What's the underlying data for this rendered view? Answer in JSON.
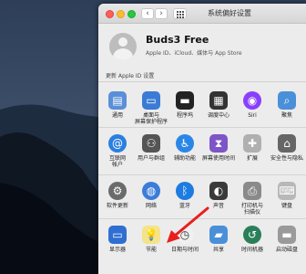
{
  "window": {
    "title": "系统偏好设置"
  },
  "nav": {
    "back": "‹",
    "forward": "›"
  },
  "account": {
    "name": "Buds3 Free",
    "subtitle": "Apple ID、iCloud、媒体与 App Store",
    "update_label": "更新 Apple ID 设置"
  },
  "rows": [
    [
      {
        "label": "通用",
        "icon": "file-icon",
        "color": "#5a8fd8"
      },
      {
        "label": "桌面与\n屏幕保护程序",
        "icon": "desktop-icon",
        "color": "#3a7bd5"
      },
      {
        "label": "程序坞",
        "icon": "dock-icon",
        "color": "#222222"
      },
      {
        "label": "调度中心",
        "icon": "mission-control-icon",
        "color": "#333333"
      },
      {
        "label": "Siri",
        "icon": "siri-icon",
        "color": "#8a3ffc"
      },
      {
        "label": "聚焦",
        "icon": "search-icon",
        "color": "#4a90d9"
      }
    ],
    [
      {
        "label": "互联网\n帐户",
        "icon": "at-icon",
        "color": "#2a7fe0"
      },
      {
        "label": "用户与群组",
        "icon": "users-icon",
        "color": "#555555"
      },
      {
        "label": "辅助功能",
        "icon": "accessibility-icon",
        "color": "#2a86e6"
      },
      {
        "label": "屏幕使用时间",
        "icon": "hourglass-icon",
        "color": "#7d55c7"
      },
      {
        "label": "扩展",
        "icon": "puzzle-icon",
        "color": "#b0b0b0"
      },
      {
        "label": "安全性与隐私",
        "icon": "house-icon",
        "color": "#666666"
      }
    ],
    [
      {
        "label": "软件更新",
        "icon": "gear-icon",
        "color": "#6b6b6b"
      },
      {
        "label": "网络",
        "icon": "globe-icon",
        "color": "#3b7dd8"
      },
      {
        "label": "蓝牙",
        "icon": "bluetooth-icon",
        "color": "#1e7be0"
      },
      {
        "label": "声音",
        "icon": "speaker-icon",
        "color": "#3a3a3a"
      },
      {
        "label": "打印机与\n扫描仪",
        "icon": "printer-icon",
        "color": "#8a8a8a"
      },
      {
        "label": "键盘",
        "icon": "keyboard-icon",
        "color": "#b8b8b8"
      }
    ],
    [
      {
        "label": "显示器",
        "icon": "display-icon",
        "color": "#2f6fd1"
      },
      {
        "label": "节能",
        "icon": "lightbulb-icon",
        "color": "#f4e38a"
      },
      {
        "label": "日期与时间",
        "icon": "clock-icon",
        "color": "#f0f0f0"
      },
      {
        "label": "共享",
        "icon": "folder-icon",
        "color": "#4a90d9"
      },
      {
        "label": "时间机器",
        "icon": "time-machine-icon",
        "color": "#2a7f5a"
      },
      {
        "label": "启动磁盘",
        "icon": "disk-icon",
        "color": "#9a9a9a"
      }
    ]
  ]
}
